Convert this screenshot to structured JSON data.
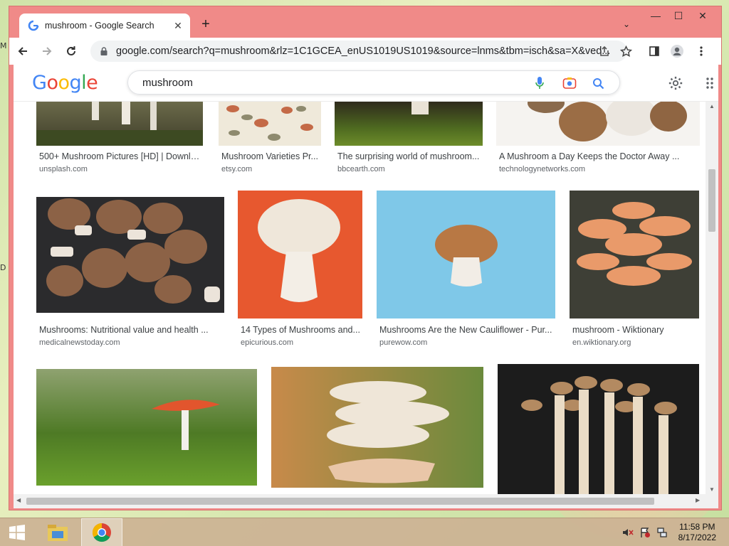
{
  "browser": {
    "tab_title": "mushroom - Google Search",
    "new_tab_symbol": "+",
    "address_url": "google.com/search?q=mushroom&rlz=1C1GCEA_enUS1019US1019&source=lnms&tbm=isch&sa=X&ved...",
    "minimize_symbol": "—",
    "maximize_symbol": "☐",
    "close_symbol": "✕"
  },
  "google": {
    "logo_letters": [
      "G",
      "o",
      "o",
      "g",
      "l",
      "e"
    ],
    "logo_colors": [
      "#4285f4",
      "#ea4335",
      "#fbbc05",
      "#4285f4",
      "#34a853",
      "#ea4335"
    ],
    "search_query": "mushroom"
  },
  "results": [
    {
      "title": "500+ Mushroom Pictures [HD] | Downlo...",
      "source": "unsplash.com"
    },
    {
      "title": "Mushroom Varieties Pr...",
      "source": "etsy.com"
    },
    {
      "title": "The surprising world of mushroom...",
      "source": "bbcearth.com"
    },
    {
      "title": "A Mushroom a Day Keeps the Doctor Away ...",
      "source": "technologynetworks.com"
    },
    {
      "title": "Mushrooms: Nutritional value and health ...",
      "source": "medicalnewstoday.com"
    },
    {
      "title": "14 Types of Mushrooms and...",
      "source": "epicurious.com"
    },
    {
      "title": "Mushrooms Are the New Cauliflower - Pur...",
      "source": "purewow.com"
    },
    {
      "title": "mushroom - Wiktionary",
      "source": "en.wiktionary.org"
    },
    {
      "title": "",
      "source": ""
    },
    {
      "title": "",
      "source": ""
    },
    {
      "title": "",
      "source": ""
    }
  ],
  "taskbar": {
    "time": "11:58 PM",
    "date": "8/17/2022"
  },
  "colors": {
    "window_frame": "#f08a88",
    "google_blue": "#4285f4",
    "taskbar": "#ccb294"
  }
}
